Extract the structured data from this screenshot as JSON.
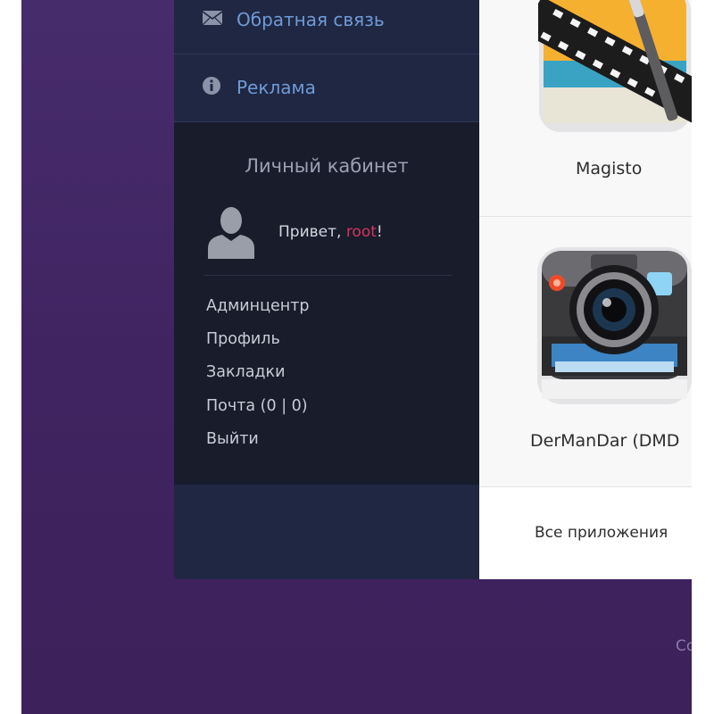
{
  "nav": {
    "feedback_label": "Обратная связь",
    "feedback_icon": "envelope-icon",
    "ads_label": "Реклама",
    "ads_icon": "info-icon"
  },
  "cabinet": {
    "title": "Личный кабинет",
    "greeting_prefix": "Привет, ",
    "username": "root",
    "greeting_suffix": "!",
    "links": [
      "Админцентр",
      "Профиль",
      "Закладки",
      "Почта (0 | 0)",
      "Выйти"
    ]
  },
  "apps": {
    "items": [
      {
        "name": "Magisto",
        "icon": "film-wand-icon"
      },
      {
        "name": "DerManDar (DMD",
        "icon": "camera-icon"
      }
    ],
    "all_label": "Все приложения"
  },
  "footer": {
    "partial_text": "Co"
  },
  "colors": {
    "background": "#402462",
    "sidebar": "#1f2742",
    "cabinet": "#181c2b",
    "nav_link": "#6f9bd6",
    "username": "#d6345e"
  }
}
